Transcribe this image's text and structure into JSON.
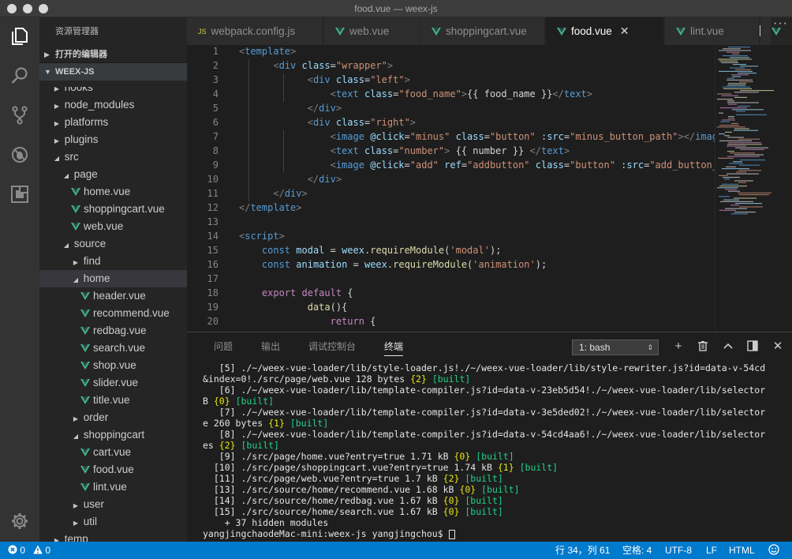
{
  "window": {
    "title": "food.vue — weex-js"
  },
  "sidebar": {
    "title": "资源管理器",
    "open_editors": "打开的编辑器",
    "project": "WEEX-JS",
    "tree": [
      {
        "label": "hooks",
        "depth": 1,
        "type": "folder-closed"
      },
      {
        "label": "node_modules",
        "depth": 1,
        "type": "folder-closed"
      },
      {
        "label": "platforms",
        "depth": 1,
        "type": "folder-closed"
      },
      {
        "label": "plugins",
        "depth": 1,
        "type": "folder-closed"
      },
      {
        "label": "src",
        "depth": 1,
        "type": "folder-open"
      },
      {
        "label": "page",
        "depth": 2,
        "type": "folder-open"
      },
      {
        "label": "home.vue",
        "depth": 3,
        "type": "vue"
      },
      {
        "label": "shoppingcart.vue",
        "depth": 3,
        "type": "vue"
      },
      {
        "label": "web.vue",
        "depth": 3,
        "type": "vue"
      },
      {
        "label": "source",
        "depth": 2,
        "type": "folder-open"
      },
      {
        "label": "find",
        "depth": 3,
        "type": "folder-closed"
      },
      {
        "label": "home",
        "depth": 3,
        "type": "folder-open",
        "selected": true
      },
      {
        "label": "header.vue",
        "depth": 4,
        "type": "vue"
      },
      {
        "label": "recommend.vue",
        "depth": 4,
        "type": "vue"
      },
      {
        "label": "redbag.vue",
        "depth": 4,
        "type": "vue"
      },
      {
        "label": "search.vue",
        "depth": 4,
        "type": "vue"
      },
      {
        "label": "shop.vue",
        "depth": 4,
        "type": "vue"
      },
      {
        "label": "slider.vue",
        "depth": 4,
        "type": "vue"
      },
      {
        "label": "title.vue",
        "depth": 4,
        "type": "vue"
      },
      {
        "label": "order",
        "depth": 3,
        "type": "folder-closed"
      },
      {
        "label": "shoppingcart",
        "depth": 3,
        "type": "folder-open"
      },
      {
        "label": "cart.vue",
        "depth": 4,
        "type": "vue"
      },
      {
        "label": "food.vue",
        "depth": 4,
        "type": "vue"
      },
      {
        "label": "lint.vue",
        "depth": 4,
        "type": "vue"
      },
      {
        "label": "user",
        "depth": 3,
        "type": "folder-closed"
      },
      {
        "label": "util",
        "depth": 3,
        "type": "folder-closed"
      },
      {
        "label": "temp",
        "depth": 1,
        "type": "folder-closed"
      }
    ]
  },
  "tabs": [
    {
      "label": "webpack.config.js",
      "kind": "js",
      "badge": "JS"
    },
    {
      "label": "web.vue",
      "kind": "vue"
    },
    {
      "label": "shoppingcart.vue",
      "kind": "vue"
    },
    {
      "label": "food.vue",
      "kind": "vue",
      "active": true
    },
    {
      "label": "lint.vue",
      "kind": "vue"
    }
  ],
  "editor": {
    "line_numbers": [
      "1",
      "2",
      "3",
      "4",
      "5",
      "6",
      "7",
      "8",
      "9",
      "10",
      "11",
      "12",
      "13",
      "14",
      "15",
      "16",
      "17",
      "18",
      "19",
      "20"
    ],
    "lines": [
      [
        [
          "t",
          "<"
        ],
        [
          "tg",
          "template"
        ],
        [
          "t",
          ">"
        ]
      ],
      [
        [
          "p",
          "      "
        ],
        [
          "t",
          "<"
        ],
        [
          "tg",
          "div"
        ],
        [
          "p",
          " "
        ],
        [
          "at",
          "class"
        ],
        [
          "p",
          "="
        ],
        [
          "s",
          "\"wrapper\""
        ],
        [
          "t",
          ">"
        ]
      ],
      [
        [
          "p",
          "            "
        ],
        [
          "t",
          "<"
        ],
        [
          "tg",
          "div"
        ],
        [
          "p",
          " "
        ],
        [
          "at",
          "class"
        ],
        [
          "p",
          "="
        ],
        [
          "s",
          "\"left\""
        ],
        [
          "t",
          ">"
        ]
      ],
      [
        [
          "p",
          "                "
        ],
        [
          "t",
          "<"
        ],
        [
          "tg",
          "text"
        ],
        [
          "p",
          " "
        ],
        [
          "at",
          "class"
        ],
        [
          "p",
          "="
        ],
        [
          "s",
          "\"food_name\""
        ],
        [
          "t",
          ">"
        ],
        [
          "p",
          "{{ food_name }}"
        ],
        [
          "t",
          "</"
        ],
        [
          "tg",
          "text"
        ],
        [
          "t",
          ">"
        ]
      ],
      [
        [
          "p",
          "            "
        ],
        [
          "t",
          "</"
        ],
        [
          "tg",
          "div"
        ],
        [
          "t",
          ">"
        ]
      ],
      [
        [
          "p",
          "            "
        ],
        [
          "t",
          "<"
        ],
        [
          "tg",
          "div"
        ],
        [
          "p",
          " "
        ],
        [
          "at",
          "class"
        ],
        [
          "p",
          "="
        ],
        [
          "s",
          "\"right\""
        ],
        [
          "t",
          ">"
        ]
      ],
      [
        [
          "p",
          "                "
        ],
        [
          "t",
          "<"
        ],
        [
          "tg",
          "image"
        ],
        [
          "p",
          " "
        ],
        [
          "at",
          "@click"
        ],
        [
          "p",
          "="
        ],
        [
          "s",
          "\"minus\""
        ],
        [
          "p",
          " "
        ],
        [
          "at",
          "class"
        ],
        [
          "p",
          "="
        ],
        [
          "s",
          "\"button\""
        ],
        [
          "p",
          " "
        ],
        [
          "at",
          ":src"
        ],
        [
          "p",
          "="
        ],
        [
          "s",
          "\"minus_button_path\""
        ],
        [
          "t",
          ">"
        ],
        [
          "t",
          "</"
        ],
        [
          "tg",
          "image"
        ],
        [
          "t",
          ">"
        ]
      ],
      [
        [
          "p",
          "                "
        ],
        [
          "t",
          "<"
        ],
        [
          "tg",
          "text"
        ],
        [
          "p",
          " "
        ],
        [
          "at",
          "class"
        ],
        [
          "p",
          "="
        ],
        [
          "s",
          "\"number\""
        ],
        [
          "t",
          ">"
        ],
        [
          "p",
          " {{ number }} "
        ],
        [
          "t",
          "</"
        ],
        [
          "tg",
          "text"
        ],
        [
          "t",
          ">"
        ]
      ],
      [
        [
          "p",
          "                "
        ],
        [
          "t",
          "<"
        ],
        [
          "tg",
          "image"
        ],
        [
          "p",
          " "
        ],
        [
          "at",
          "@click"
        ],
        [
          "p",
          "="
        ],
        [
          "s",
          "\"add\""
        ],
        [
          "p",
          " "
        ],
        [
          "at",
          "ref"
        ],
        [
          "p",
          "="
        ],
        [
          "s",
          "\"addbutton\""
        ],
        [
          "p",
          " "
        ],
        [
          "at",
          "class"
        ],
        [
          "p",
          "="
        ],
        [
          "s",
          "\"button\""
        ],
        [
          "p",
          " "
        ],
        [
          "at",
          ":src"
        ],
        [
          "p",
          "="
        ],
        [
          "s",
          "\"add_button_path\""
        ],
        [
          "t",
          ">"
        ]
      ],
      [
        [
          "p",
          "            "
        ],
        [
          "t",
          "</"
        ],
        [
          "tg",
          "div"
        ],
        [
          "t",
          ">"
        ]
      ],
      [
        [
          "p",
          "      "
        ],
        [
          "t",
          "</"
        ],
        [
          "tg",
          "div"
        ],
        [
          "t",
          ">"
        ]
      ],
      [
        [
          "t",
          "</"
        ],
        [
          "tg",
          "template"
        ],
        [
          "t",
          ">"
        ]
      ],
      [],
      [
        [
          "t",
          "<"
        ],
        [
          "tg",
          "script"
        ],
        [
          "t",
          ">"
        ]
      ],
      [
        [
          "p",
          "    "
        ],
        [
          "kw",
          "const"
        ],
        [
          "p",
          " "
        ],
        [
          "v",
          "modal"
        ],
        [
          "p",
          " = "
        ],
        [
          "v",
          "weex"
        ],
        [
          "p",
          "."
        ],
        [
          "fn",
          "requireModule"
        ],
        [
          "p",
          "("
        ],
        [
          "s",
          "'modal'"
        ],
        [
          "p",
          ");"
        ]
      ],
      [
        [
          "p",
          "    "
        ],
        [
          "kw",
          "const"
        ],
        [
          "p",
          " "
        ],
        [
          "v",
          "animation"
        ],
        [
          "p",
          " = "
        ],
        [
          "v",
          "weex"
        ],
        [
          "p",
          "."
        ],
        [
          "fn",
          "requireModule"
        ],
        [
          "p",
          "("
        ],
        [
          "s",
          "'animation'"
        ],
        [
          "p",
          ");"
        ]
      ],
      [],
      [
        [
          "p",
          "    "
        ],
        [
          "kc",
          "export"
        ],
        [
          "p",
          " "
        ],
        [
          "kc",
          "default"
        ],
        [
          "p",
          " {"
        ]
      ],
      [
        [
          "p",
          "            "
        ],
        [
          "fn",
          "data"
        ],
        [
          "p",
          "(){"
        ]
      ],
      [
        [
          "p",
          "                "
        ],
        [
          "kc",
          "return"
        ],
        [
          "p",
          " {"
        ]
      ]
    ]
  },
  "panel": {
    "tabs": [
      {
        "label": "问题"
      },
      {
        "label": "输出"
      },
      {
        "label": "调试控制台"
      },
      {
        "label": "终端",
        "active": true
      }
    ],
    "terminal_select": "1: bash",
    "terminal_lines": [
      [
        [
          "w",
          "   [5] ./~/weex-vue-loader/lib/style-loader.js!./~/weex-vue-loader/lib/style-rewriter.js?id=data-v-54cd"
        ]
      ],
      [
        [
          "w",
          "&index=0!./src/page/web.vue 128 bytes "
        ],
        [
          "y",
          "{2}"
        ],
        [
          "w",
          " "
        ],
        [
          "g",
          "[built]"
        ]
      ],
      [
        [
          "w",
          "   [6] ./~/weex-vue-loader/lib/template-compiler.js?id=data-v-23eb5d54!./~/weex-vue-loader/lib/selector"
        ]
      ],
      [
        [
          "w",
          "B "
        ],
        [
          "y",
          "{0}"
        ],
        [
          "w",
          " "
        ],
        [
          "g",
          "[built]"
        ]
      ],
      [
        [
          "w",
          "   [7] ./~/weex-vue-loader/lib/template-compiler.js?id=data-v-3e5ded02!./~/weex-vue-loader/lib/selector"
        ]
      ],
      [
        [
          "w",
          "e 260 bytes "
        ],
        [
          "y",
          "{1}"
        ],
        [
          "w",
          " "
        ],
        [
          "g",
          "[built]"
        ]
      ],
      [
        [
          "w",
          "   [8] ./~/weex-vue-loader/lib/template-compiler.js?id=data-v-54cd4aa6!./~/weex-vue-loader/lib/selector"
        ]
      ],
      [
        [
          "w",
          "es "
        ],
        [
          "y",
          "{2}"
        ],
        [
          "w",
          " "
        ],
        [
          "g",
          "[built]"
        ]
      ],
      [
        [
          "w",
          "   [9] ./src/page/home.vue?entry=true 1.71 kB "
        ],
        [
          "y",
          "{0}"
        ],
        [
          "w",
          " "
        ],
        [
          "g",
          "[built]"
        ]
      ],
      [
        [
          "w",
          "  [10] ./src/page/shoppingcart.vue?entry=true 1.74 kB "
        ],
        [
          "y",
          "{1}"
        ],
        [
          "w",
          " "
        ],
        [
          "g",
          "[built]"
        ]
      ],
      [
        [
          "w",
          "  [11] ./src/page/web.vue?entry=true 1.7 kB "
        ],
        [
          "y",
          "{2}"
        ],
        [
          "w",
          " "
        ],
        [
          "g",
          "[built]"
        ]
      ],
      [
        [
          "w",
          "  [13] ./src/source/home/recommend.vue 1.68 kB "
        ],
        [
          "y",
          "{0}"
        ],
        [
          "w",
          " "
        ],
        [
          "g",
          "[built]"
        ]
      ],
      [
        [
          "w",
          "  [14] ./src/source/home/redbag.vue 1.67 kB "
        ],
        [
          "y",
          "{0}"
        ],
        [
          "w",
          " "
        ],
        [
          "g",
          "[built]"
        ]
      ],
      [
        [
          "w",
          "  [15] ./src/source/home/search.vue 1.67 kB "
        ],
        [
          "y",
          "{0}"
        ],
        [
          "w",
          " "
        ],
        [
          "g",
          "[built]"
        ]
      ],
      [
        [
          "w",
          "    + 37 hidden modules"
        ]
      ],
      [
        [
          "w",
          "yangjingchaodeMac-mini:weex-js yangjingchou$ "
        ],
        [
          "c",
          ""
        ]
      ]
    ]
  },
  "status": {
    "errors": "0",
    "warnings": "0",
    "position": "行 34，列 61",
    "indent": "空格: 4",
    "encoding": "UTF-8",
    "eol": "LF",
    "language": "HTML"
  },
  "colors": {
    "accent": "#007acc",
    "vue_green": "#41b883",
    "tag": "#569cd6",
    "attr": "#9cdcfe",
    "string": "#ce9178",
    "keyword": "#c586c0",
    "function": "#dcdcaa"
  }
}
